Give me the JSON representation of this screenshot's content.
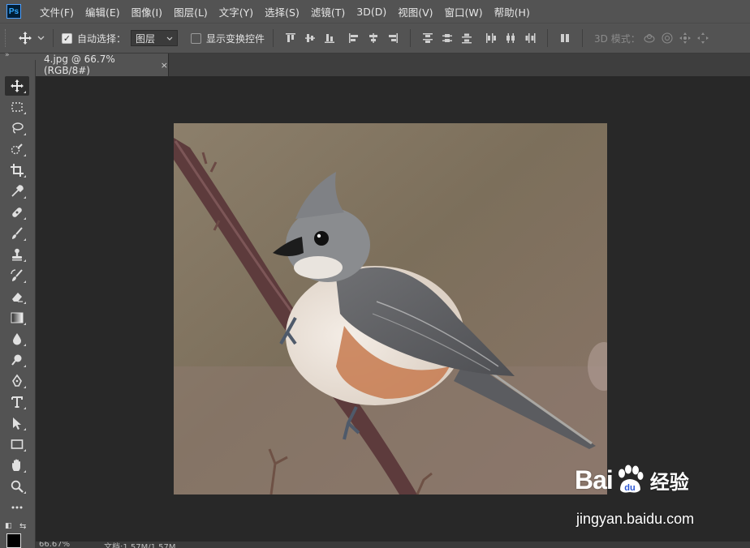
{
  "app": {
    "logo_text": "Ps",
    "menu": [
      "文件(F)",
      "编辑(E)",
      "图像(I)",
      "图层(L)",
      "文字(Y)",
      "选择(S)",
      "滤镜(T)",
      "3D(D)",
      "视图(V)",
      "窗口(W)",
      "帮助(H)"
    ]
  },
  "options": {
    "auto_select_label": "自动选择：",
    "auto_select_checked": true,
    "auto_select_target": "图层",
    "show_transform_label": "显示变换控件",
    "show_transform_checked": false,
    "mode_3d_label": "3D 模式："
  },
  "document": {
    "tab_title": "4.jpg @ 66.7%(RGB/8#)",
    "close_glyph": "×"
  },
  "status": {
    "zoom": "66.67%",
    "doc_info": "文档:1.57M/1.57M"
  },
  "tools": [
    "move-tool",
    "rectangular-marquee-tool",
    "lasso-tool",
    "quick-selection-tool",
    "crop-tool",
    "eyedropper-tool",
    "healing-brush-tool",
    "brush-tool",
    "clone-stamp-tool",
    "history-brush-tool",
    "eraser-tool",
    "gradient-tool",
    "blur-tool",
    "dodge-tool",
    "pen-tool",
    "type-tool",
    "path-selection-tool",
    "rectangle-tool",
    "hand-tool",
    "zoom-tool",
    "more-tools"
  ],
  "watermark": {
    "brand_left": "Bai",
    "brand_right": "经验",
    "url": "jingyan.baidu.com"
  },
  "colors": {
    "ui_panel": "#535353",
    "canvas_bg": "#282828",
    "foreground_color": "#000000"
  }
}
